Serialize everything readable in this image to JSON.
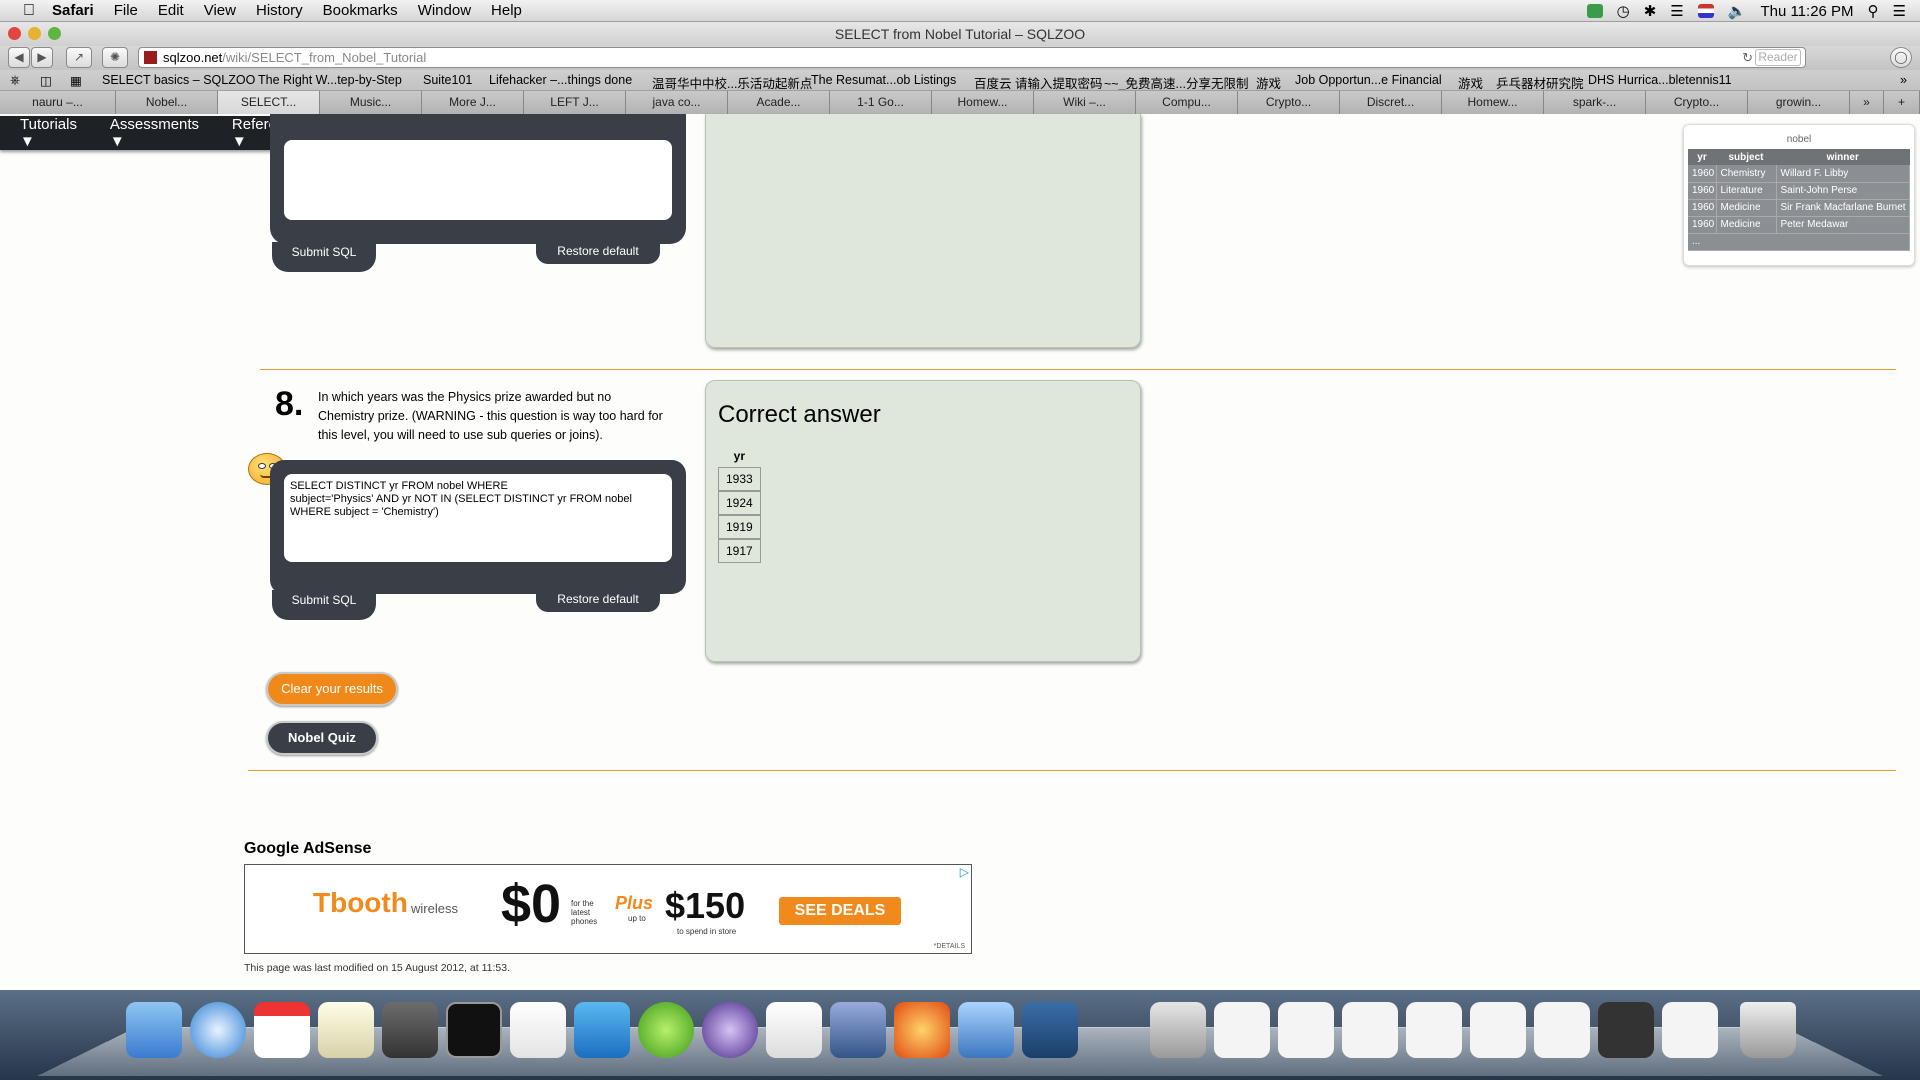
{
  "menubar": {
    "items": [
      "Safari",
      "File",
      "Edit",
      "View",
      "History",
      "Bookmarks",
      "Window",
      "Help"
    ],
    "clock": "Thu 11:26 PM"
  },
  "window": {
    "title": "SELECT from Nobel Tutorial – SQLZOO"
  },
  "toolbar": {
    "url_host": "sqlzoo.net",
    "url_path": "/wiki/SELECT_from_Nobel_Tutorial",
    "reader_label": "Reader"
  },
  "bookmarks": [
    "SELECT basics – SQLZOO",
    "The Right W...tep-by-Step",
    "Suite101",
    "Lifehacker –...things done",
    "温哥华中中校...乐活动起新点",
    "The Resumat...ob Listings",
    "百度云 请输入提取密码",
    "~~_免费高速...分享无限制",
    "游戏",
    "Job Opportun...e Financial",
    "游戏",
    "乒乓器材研究院",
    "DHS Hurrica...bletennis11"
  ],
  "tabs": [
    "nauru –...",
    "Nobel...",
    "SELECT...",
    "Music...",
    "More J...",
    "LEFT J...",
    "java co...",
    "Acade...",
    "1-1 Go...",
    "Homew...",
    "Wiki –...",
    "Compu...",
    "Crypto...",
    "Discret...",
    "Homew...",
    "spark-...",
    "Crypto...",
    "growin..."
  ],
  "pagenav": {
    "tutorials": "Tutorials ▼",
    "assessments": "Assessments ▼",
    "reference": "Reference ▼"
  },
  "q7": {
    "submit": "Submit SQL",
    "restore": "Restore default"
  },
  "q8": {
    "number": "8.",
    "question": "In which years was the Physics prize awarded but no Chemistry prize. (WARNING - this question is way too hard for this level, you will need to use sub queries or joins).",
    "sql": "SELECT DISTINCT yr FROM nobel WHERE\nsubject='Physics' AND yr NOT IN (SELECT DISTINCT yr FROM nobel\nWHERE subject = 'Chemistry')",
    "submit": "Submit SQL",
    "restore": "Restore default",
    "result_title": "Correct answer",
    "result_header": "yr",
    "result_rows": [
      "1933",
      "1924",
      "1919",
      "1917"
    ]
  },
  "buttons": {
    "clear": "Clear your results",
    "quiz": "Nobel Quiz"
  },
  "sample_table": {
    "caption": "nobel",
    "headers": [
      "yr",
      "subject",
      "winner"
    ],
    "rows": [
      [
        "1960",
        "Chemistry",
        "Willard F. Libby"
      ],
      [
        "1960",
        "Literature",
        "Saint-John Perse"
      ],
      [
        "1960",
        "Medicine",
        "Sir Frank Macfarlane Burnet"
      ],
      [
        "1960",
        "Medicine",
        "Peter Medawar"
      ]
    ],
    "ellipsis": "..."
  },
  "adsense": {
    "heading": "Google AdSense",
    "brand": "Tbooth",
    "brand_suffix": "wireless",
    "price": "$0",
    "price_note": "for the latest phones",
    "plus": "Plus",
    "plus_note": "up to",
    "amount": "$150",
    "amount_note": "to spend in store",
    "cta": "SEE DEALS",
    "details": "*DETAILS"
  },
  "footer": {
    "modified": "This page was last modified on 15 August 2012, at 11:53."
  },
  "colors": {
    "accent": "#e59c3b",
    "dark": "#3a3f47",
    "panel": "#dfe6da",
    "orange_button": "#ef8a1a"
  }
}
